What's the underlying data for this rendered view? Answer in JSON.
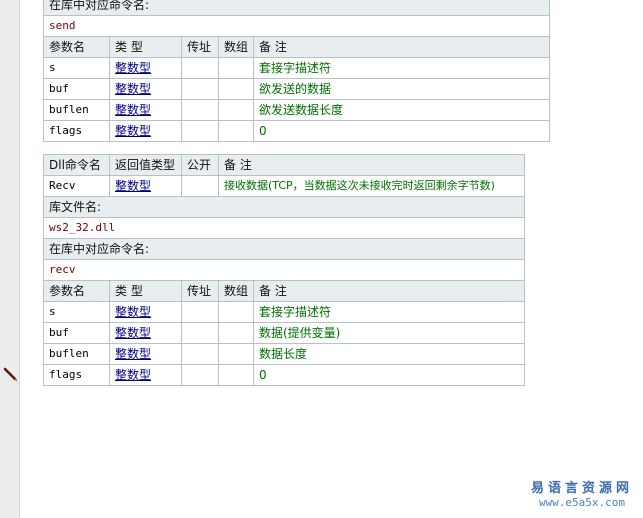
{
  "labels": {
    "cmd_in_lib": "在库中对应命令名:",
    "param_name": "参数名",
    "type": "类 型",
    "by_ref": "传址",
    "array": "数组",
    "note": "备 注",
    "dll_cmd": "Dll命令名",
    "return_type": "返回值类型",
    "public": "公开",
    "lib_file": "库文件名:"
  },
  "send": {
    "lib_cmd": "send",
    "params": [
      {
        "name": "s",
        "type": "整数型",
        "note": "套接字描述符"
      },
      {
        "name": "buf",
        "type": "整数型",
        "note": "欲发送的数据"
      },
      {
        "name": "buflen",
        "type": "整数型",
        "note": "欲发送数据长度"
      },
      {
        "name": "flags",
        "type": "整数型",
        "note": "0"
      }
    ]
  },
  "recv": {
    "dll_name": "Recv",
    "return_type": "整数型",
    "note": "接收数据(TCP，当数据这次未接收完时返回剩余字节数)",
    "lib_file": "ws2_32.dll",
    "lib_cmd": "recv",
    "params": [
      {
        "name": "s",
        "type": "整数型",
        "note": "套接字描述符"
      },
      {
        "name": "buf",
        "type": "整数型",
        "note": "数据(提供变量)"
      },
      {
        "name": "buflen",
        "type": "整数型",
        "note": "数据长度"
      },
      {
        "name": "flags",
        "type": "整数型",
        "note": "0"
      }
    ]
  },
  "watermark": {
    "line1": "易语言资源网",
    "line2": "www.e5a5x.com"
  },
  "icons": {
    "left_margin": "pen-icon"
  }
}
